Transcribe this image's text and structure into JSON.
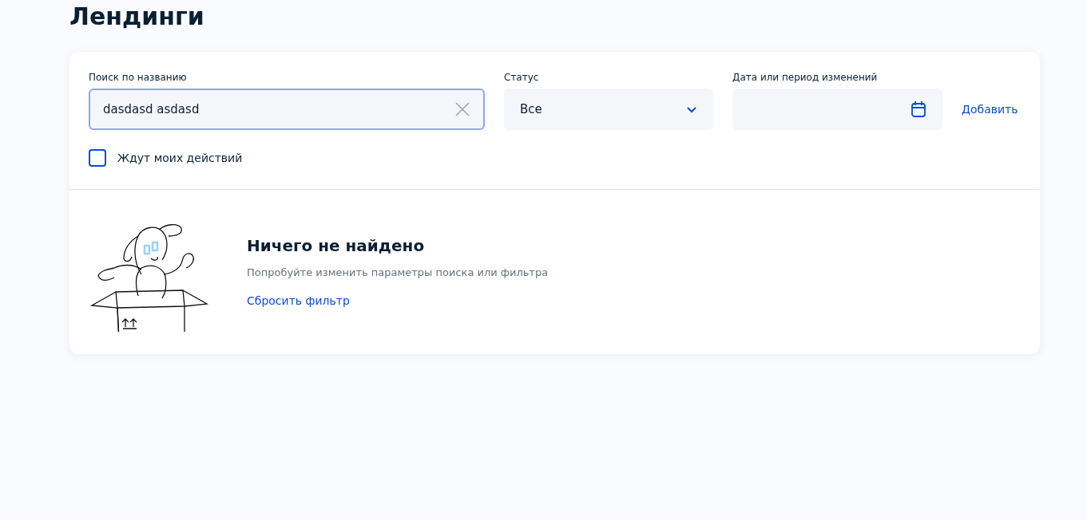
{
  "page": {
    "title": "Лендинги"
  },
  "filters": {
    "search": {
      "label": "Поиск по названию",
      "value": "dasdasd asdasd",
      "focused": true
    },
    "status": {
      "label": "Статус",
      "value": "Все"
    },
    "date": {
      "label": "Дата или период изменений"
    },
    "add_link": "Добавить",
    "awaiting": {
      "label": "Ждут моих действий",
      "checked": false
    }
  },
  "empty_state": {
    "title": "Ничего не найдено",
    "message": "Попробуйте изменить параметры поиска или фильтра",
    "reset_link": "Сбросить фильтр"
  }
}
